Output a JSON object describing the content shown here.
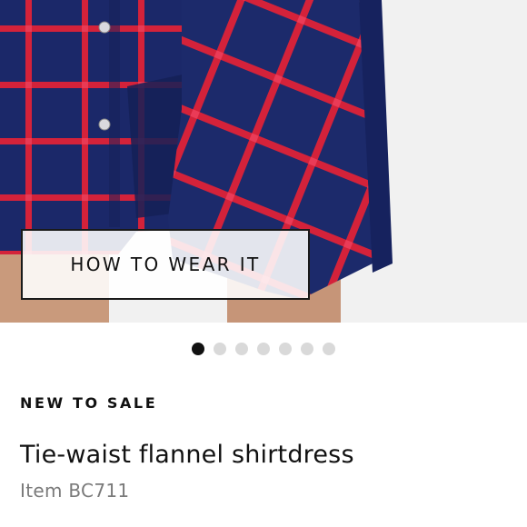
{
  "hero": {
    "image_alt": "Plaid flannel shirtdress",
    "cta_label": "HOW TO WEAR IT",
    "colors": {
      "navy": "#1b2869",
      "red": "#d4223a",
      "skin": "#c99a7c",
      "background": "#f1f1f1"
    }
  },
  "carousel": {
    "total": 7,
    "active_index": 0
  },
  "product": {
    "badge": "NEW TO SALE",
    "name": "Tie-waist flannel shirtdress",
    "item_number": "Item BC711"
  }
}
